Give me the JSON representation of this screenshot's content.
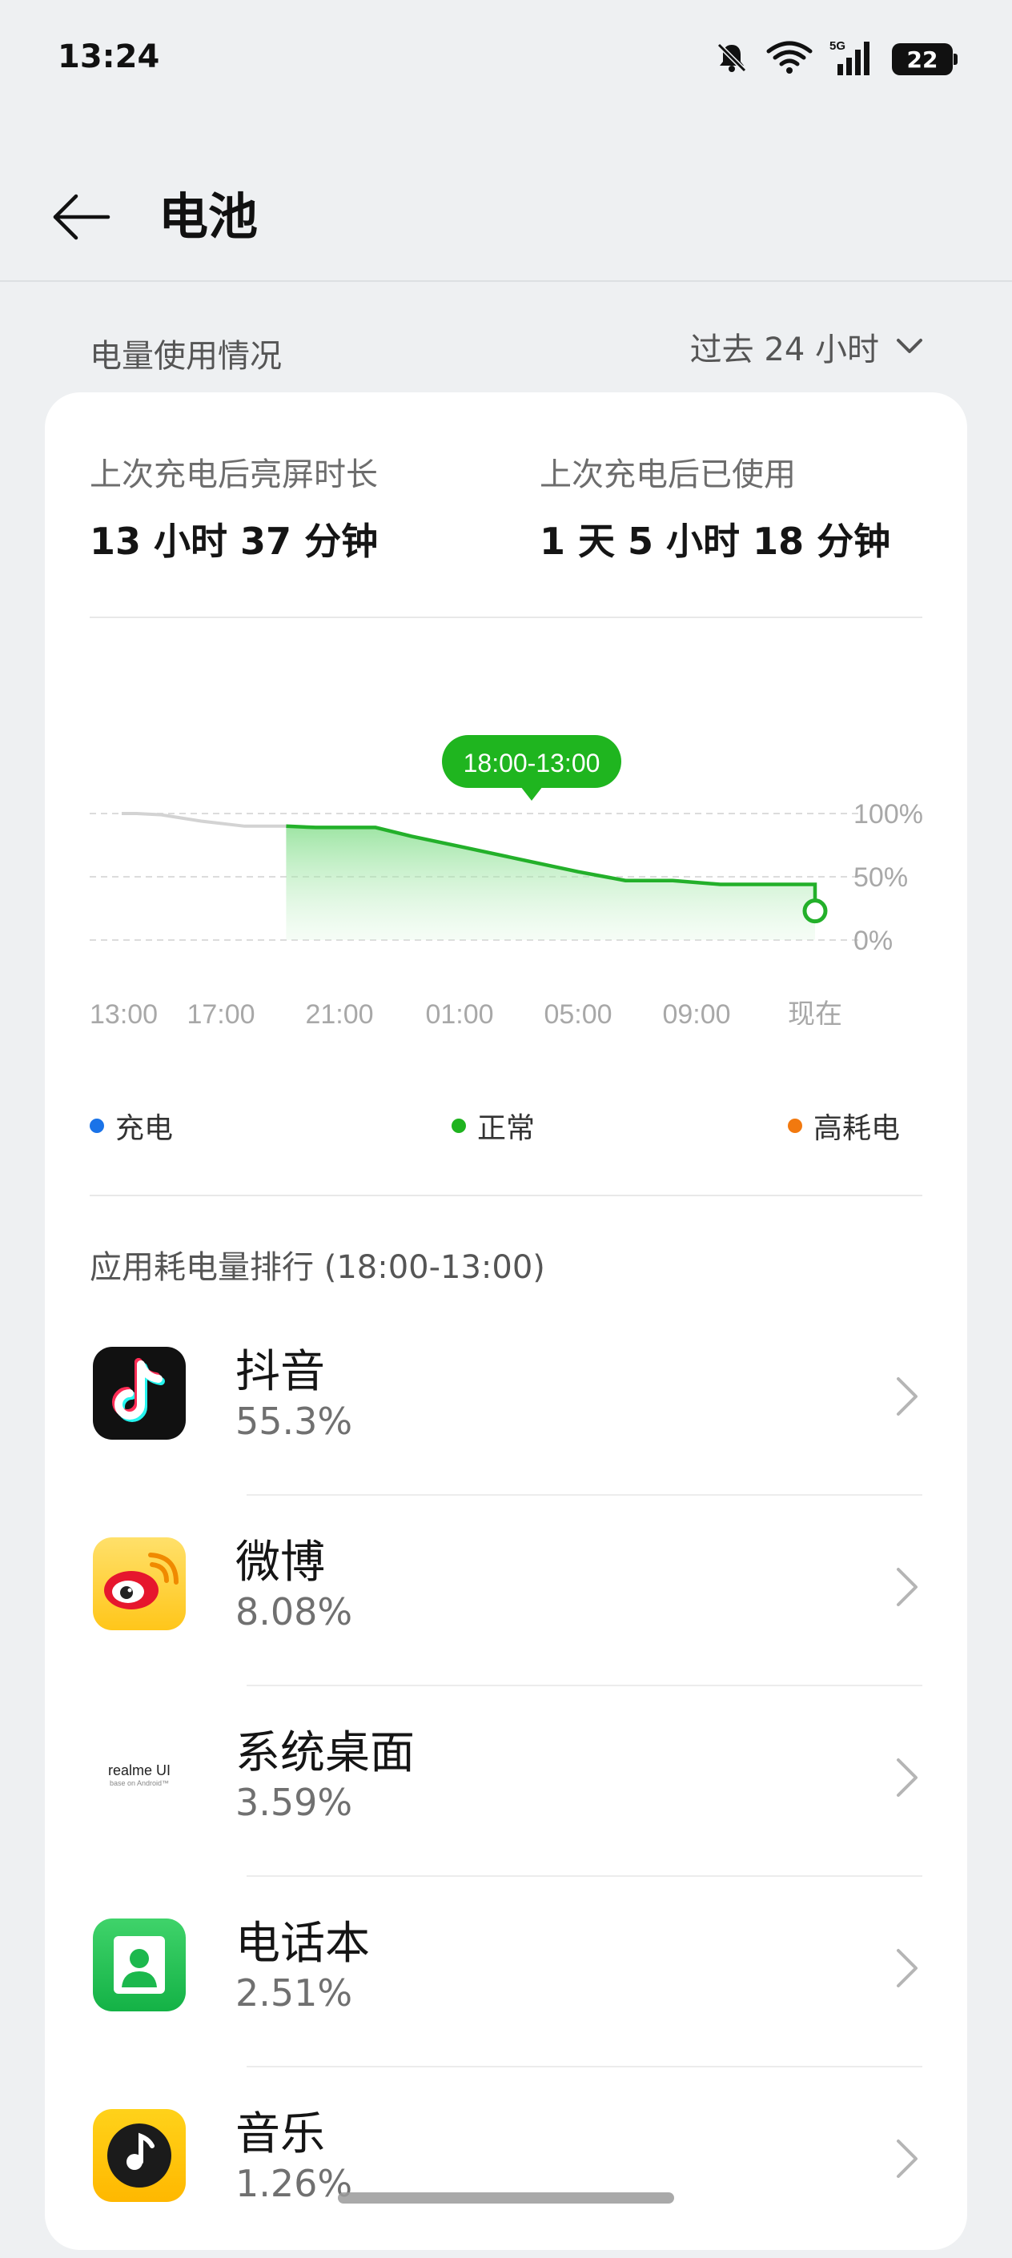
{
  "status_bar": {
    "time": "13:24",
    "battery": "22",
    "network": "5G"
  },
  "header": {
    "title": "电池"
  },
  "usage": {
    "section_label": "电量使用情况",
    "period": "过去 24 小时"
  },
  "stats": [
    {
      "label": "上次充电后亮屏时长",
      "value": "13 小时 37 分钟"
    },
    {
      "label": "上次充电后已使用",
      "value": "1 天 5 小时 18 分钟"
    }
  ],
  "chart_data": {
    "type": "area",
    "selection_label": "18:00-13:00",
    "x_ticks": [
      "13:00",
      "17:00",
      "21:00",
      "01:00",
      "05:00",
      "09:00",
      "现在"
    ],
    "y_ticks": [
      "100%",
      "50%",
      "0%"
    ],
    "ylim": [
      0,
      100
    ],
    "series": [
      {
        "name": "",
        "style": "gray",
        "points": [
          [
            0,
            100
          ],
          [
            0.15,
            100
          ],
          [
            0.4,
            99
          ],
          [
            0.8,
            94
          ],
          [
            1.2,
            90
          ],
          [
            1.55,
            90
          ]
        ]
      },
      {
        "name": "",
        "style": "green",
        "points": [
          [
            1.55,
            90
          ],
          [
            1.8,
            89
          ],
          [
            2.3,
            89
          ],
          [
            2.6,
            82
          ],
          [
            3.0,
            74
          ],
          [
            3.5,
            64
          ],
          [
            4.0,
            54
          ],
          [
            4.4,
            47
          ],
          [
            4.8,
            47
          ],
          [
            5.2,
            44
          ],
          [
            5.6,
            44
          ],
          [
            6.0,
            44
          ],
          [
            6.4,
            43
          ],
          [
            6.8,
            42
          ],
          [
            7.2,
            38
          ],
          [
            7.5,
            33
          ],
          [
            7.8,
            23
          ]
        ]
      }
    ]
  },
  "legend": [
    {
      "label": "充电",
      "color": "#1a73e8"
    },
    {
      "label": "正常",
      "color": "#1fb31f"
    },
    {
      "label": "高耗电",
      "color": "#f2790f"
    }
  ],
  "ranking": {
    "title": "应用耗电量排行 (18:00-13:00)",
    "apps": [
      {
        "name": "抖音",
        "percent": "55.3%",
        "icon": "tiktok-icon"
      },
      {
        "name": "微博",
        "percent": "8.08%",
        "icon": "weibo-icon"
      },
      {
        "name": "系统桌面",
        "percent": "3.59%",
        "icon": "realme-ui-icon",
        "icon_text": "realme UI",
        "icon_subtext": "base on Android™"
      },
      {
        "name": "电话本",
        "percent": "2.51%",
        "icon": "contacts-icon"
      },
      {
        "name": "音乐",
        "percent": "1.26%",
        "icon": "music-icon"
      }
    ]
  }
}
